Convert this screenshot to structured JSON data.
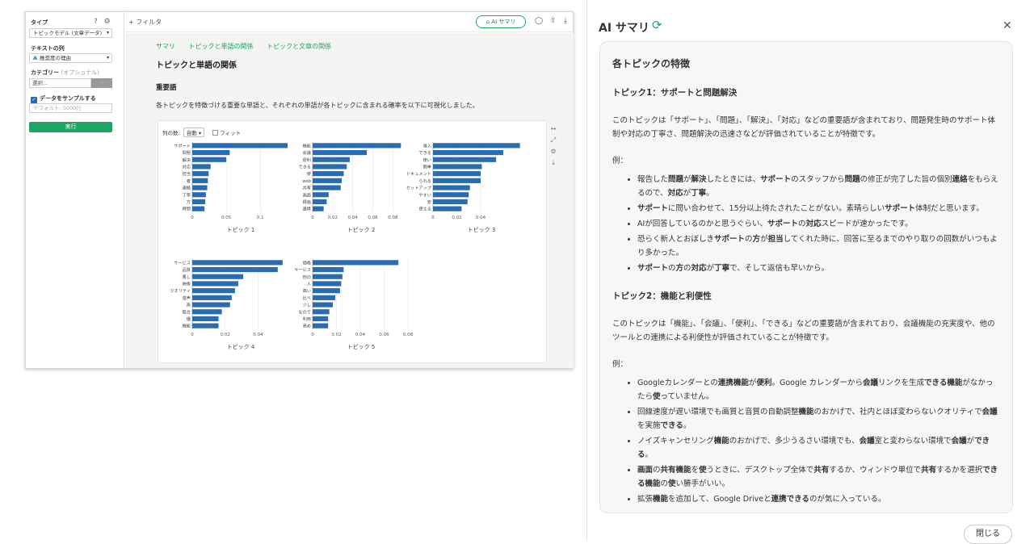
{
  "sidebar": {
    "type_label": "タイプ",
    "type_value": "トピックモデル (文章データ)",
    "text_col_label": "テキストの列",
    "text_col_type": "A",
    "text_col_value": "推奨度の理由",
    "category_label": "カテゴリー",
    "category_optional": "(オプショナル)",
    "category_placeholder": "選択...",
    "category_btn": "-",
    "sample_label": "データをサンプルする",
    "default_placeholder": "デフォルト: 5000行",
    "run_label": "実行"
  },
  "topbar": {
    "filter_label": "+ フィルタ",
    "ai_btn_label": "AI サマリ"
  },
  "content": {
    "tabs": [
      "サマリ",
      "トピックと単語の関係",
      "トピックと文章の関係"
    ],
    "title": "トピックと単語の関係",
    "section": "重要語",
    "description": "各トピックを特徴づける重要な単語と、それぞれの単語が各トピックに含まれる確率を以下に可視化しました。",
    "columns_label": "列の数:",
    "columns_value": "自動",
    "fit_label": "フィット"
  },
  "chart_data": [
    {
      "type": "bar",
      "title": "トピック 1",
      "categories": [
        "サポート",
        "問題",
        "解決",
        "対応",
        "担当",
        "者",
        "連絡",
        "丁寧",
        "方",
        "時間"
      ],
      "values": [
        0.14,
        0.055,
        0.05,
        0.027,
        0.024,
        0.023,
        0.022,
        0.02,
        0.019,
        0.018
      ],
      "xlim": [
        0,
        0.14
      ],
      "ticks": [
        "0",
        "0.05",
        "0.1"
      ],
      "tick_values": [
        0,
        0.05,
        0.1
      ]
    },
    {
      "type": "bar",
      "title": "トピック 2",
      "categories": [
        "機能",
        "会議",
        "便利",
        "できる",
        "使",
        "web",
        "共有",
        "画面",
        "録画",
        "連携"
      ],
      "values": [
        0.088,
        0.054,
        0.037,
        0.034,
        0.031,
        0.029,
        0.028,
        0.016,
        0.014,
        0.011
      ],
      "xlim": [
        0,
        0.095
      ],
      "ticks": [
        "0",
        "0.02",
        "0.04",
        "0.06",
        "0.08"
      ],
      "tick_values": [
        0,
        0.02,
        0.04,
        0.06,
        0.08
      ]
    },
    {
      "type": "bar",
      "title": "トピック 3",
      "categories": [
        "導入",
        "できる",
        "使い",
        "簡単",
        "ドキュメント",
        "られる",
        "セットアップ",
        "やすい",
        "安",
        "使える"
      ],
      "values": [
        0.073,
        0.059,
        0.053,
        0.041,
        0.04,
        0.04,
        0.031,
        0.03,
        0.029,
        0.024
      ],
      "xlim": [
        0,
        0.08
      ],
      "ticks": [
        "0",
        "0.02",
        "0.04"
      ],
      "tick_values": [
        0,
        0.02,
        0.04
      ]
    },
    {
      "type": "bar",
      "title": "トピック 4",
      "categories": [
        "サービス",
        "品質",
        "悪し",
        "映像",
        "クオリティ",
        "音声",
        "高",
        "競合",
        "優",
        "機能"
      ],
      "values": [
        0.055,
        0.052,
        0.031,
        0.028,
        0.026,
        0.024,
        0.023,
        0.018,
        0.016,
        0.016
      ],
      "xlim": [
        0,
        0.058
      ],
      "ticks": [
        "0",
        "0.02",
        "0.04"
      ],
      "tick_values": [
        0,
        0.02,
        0.04
      ]
    },
    {
      "type": "bar",
      "title": "トピック 5",
      "categories": [
        "価格",
        "サービス",
        "他の",
        "人",
        "高い",
        "比べ",
        "少し",
        "なので",
        "利用",
        "高め"
      ],
      "values": [
        0.072,
        0.026,
        0.025,
        0.024,
        0.023,
        0.019,
        0.017,
        0.014,
        0.013,
        0.013
      ],
      "xlim": [
        0,
        0.08
      ],
      "ticks": [
        "0",
        "0.02",
        "0.04",
        "0.06",
        "0.08"
      ],
      "tick_values": [
        0,
        0.02,
        0.04,
        0.06,
        0.08
      ]
    }
  ],
  "panel": {
    "title": "AI サマリ",
    "heading": "各トピックの特徴",
    "topic1_title": "トピック1：サポートと問題解決",
    "topic1_desc": "このトピックは「サポート」、「問題」、「解決」、「対応」などの重要語が含まれており、問題発生時のサポート体制や対応の丁寧さ、問題解決の迅速さなどが評価されていることが特徴です。",
    "example_label": "例：",
    "topic1_examples": [
      "報告した<b>問題</b>が<b>解決</b>したときには、<b>サポート</b>のスタッフから<b>問題</b>の修正が完了した旨の個別<b>連絡</b>をもらえるので、<b>対応</b>が<b>丁寧</b>。",
      "<b>サポート</b>に問い合わせて、15分以上待たされたことがない。素晴らしい<b>サポート</b>体制だと思います。",
      "AIが回答しているのかと思うぐらい、<b>サポート</b>の<b>対応</b>スピードが速かったです。",
      "恐らく新人とおぼしき<b>サポート</b>の<b>方</b>が<b>担当</b>してくれた時に、回答に至るまでのやり取りの回数がいつもより多かった。",
      "<b>サポート</b>の<b>方</b>の<b>対応</b>が<b>丁寧</b>で、そして返信も早いから。"
    ],
    "topic2_title": "トピック2：機能と利便性",
    "topic2_desc": "このトピックは「機能」、「会議」、「便利」、「できる」などの重要語が含まれており、会議機能の充実度や、他のツールとの連携による利便性が評価されていることが特徴です。",
    "topic2_examples": [
      "Googleカレンダーとの<b>連携機能</b>が<b>便利</b>。Google カレンダーから<b>会議</b>リンクを生成<b>できる機能</b>がなかったら<b>使</b>っていません。",
      "回線速度が遅い環境でも画質と音質の自動調整<b>機能</b>のおかげで、社内とほぼ変わらないクオリティで<b>会議</b>を実施<b>できる</b>。",
      "ノイズキャンセリング<b>機能</b>のおかげで、多少うるさい環境でも、<b>会議</b>室と変わらない環境で<b>会議</b>が<b>できる</b>。",
      "<b>画面</b>の<b>共有機能</b>を<b>使</b>うときに、デスクトップ全体で<b>共有</b>するか、ウィンドウ単位で<b>共有</b>するかを選択<b>できる機能</b>の<b>使</b>い勝手がいい。",
      "拡張<b>機能</b>を追加して、Google Driveと<b>連携できる</b>のが気に入っている。"
    ],
    "close_label": "閉じる"
  },
  "colors": {
    "bar": "#2b6cb0",
    "accent": "#1fa463"
  }
}
